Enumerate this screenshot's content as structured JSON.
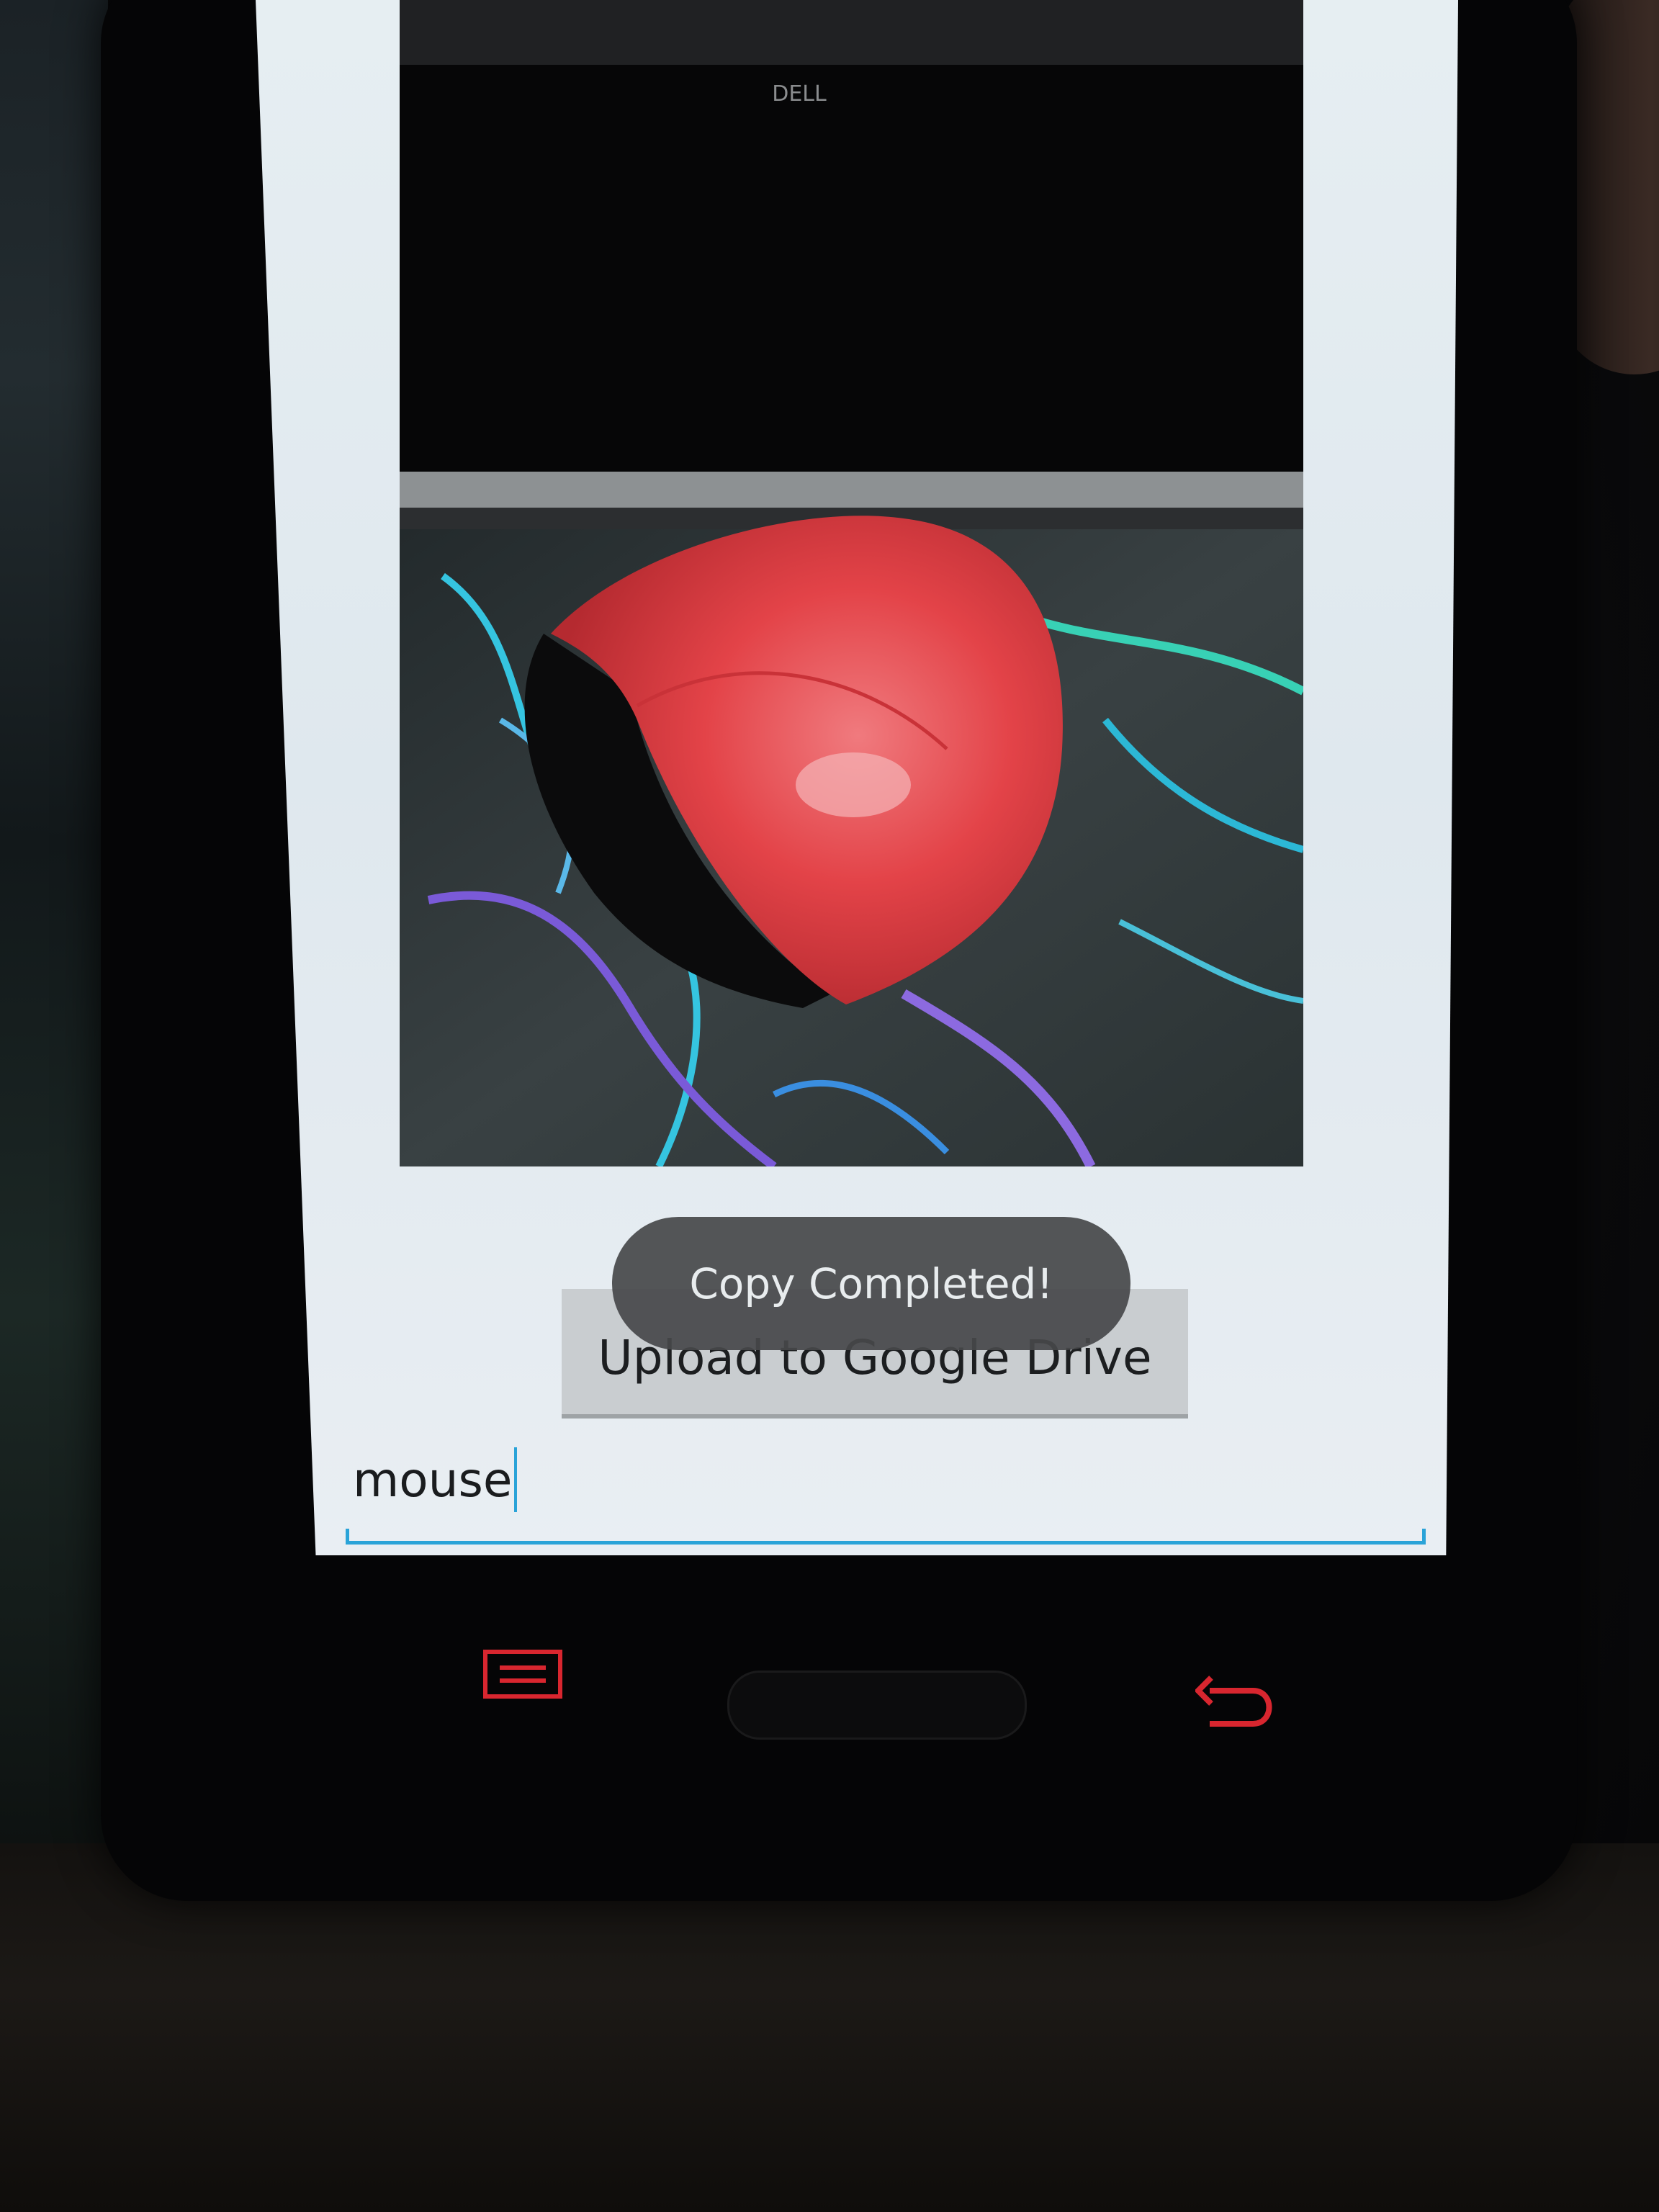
{
  "toast": {
    "message": "Copy Completed!"
  },
  "actions": {
    "upload_label": "Upload to Google Drive"
  },
  "search_input": {
    "value": "mouse"
  },
  "photo": {
    "description_icon": "photo-preview",
    "monitor_brand_logo": "DELL"
  },
  "nav": {
    "menu_icon": "menu-icon",
    "home_icon": "home-icon",
    "back_icon": "back-icon"
  },
  "colors": {
    "accent": "#2aa3d8",
    "nav_key": "#d8262f",
    "toast_bg": "#46484a"
  }
}
